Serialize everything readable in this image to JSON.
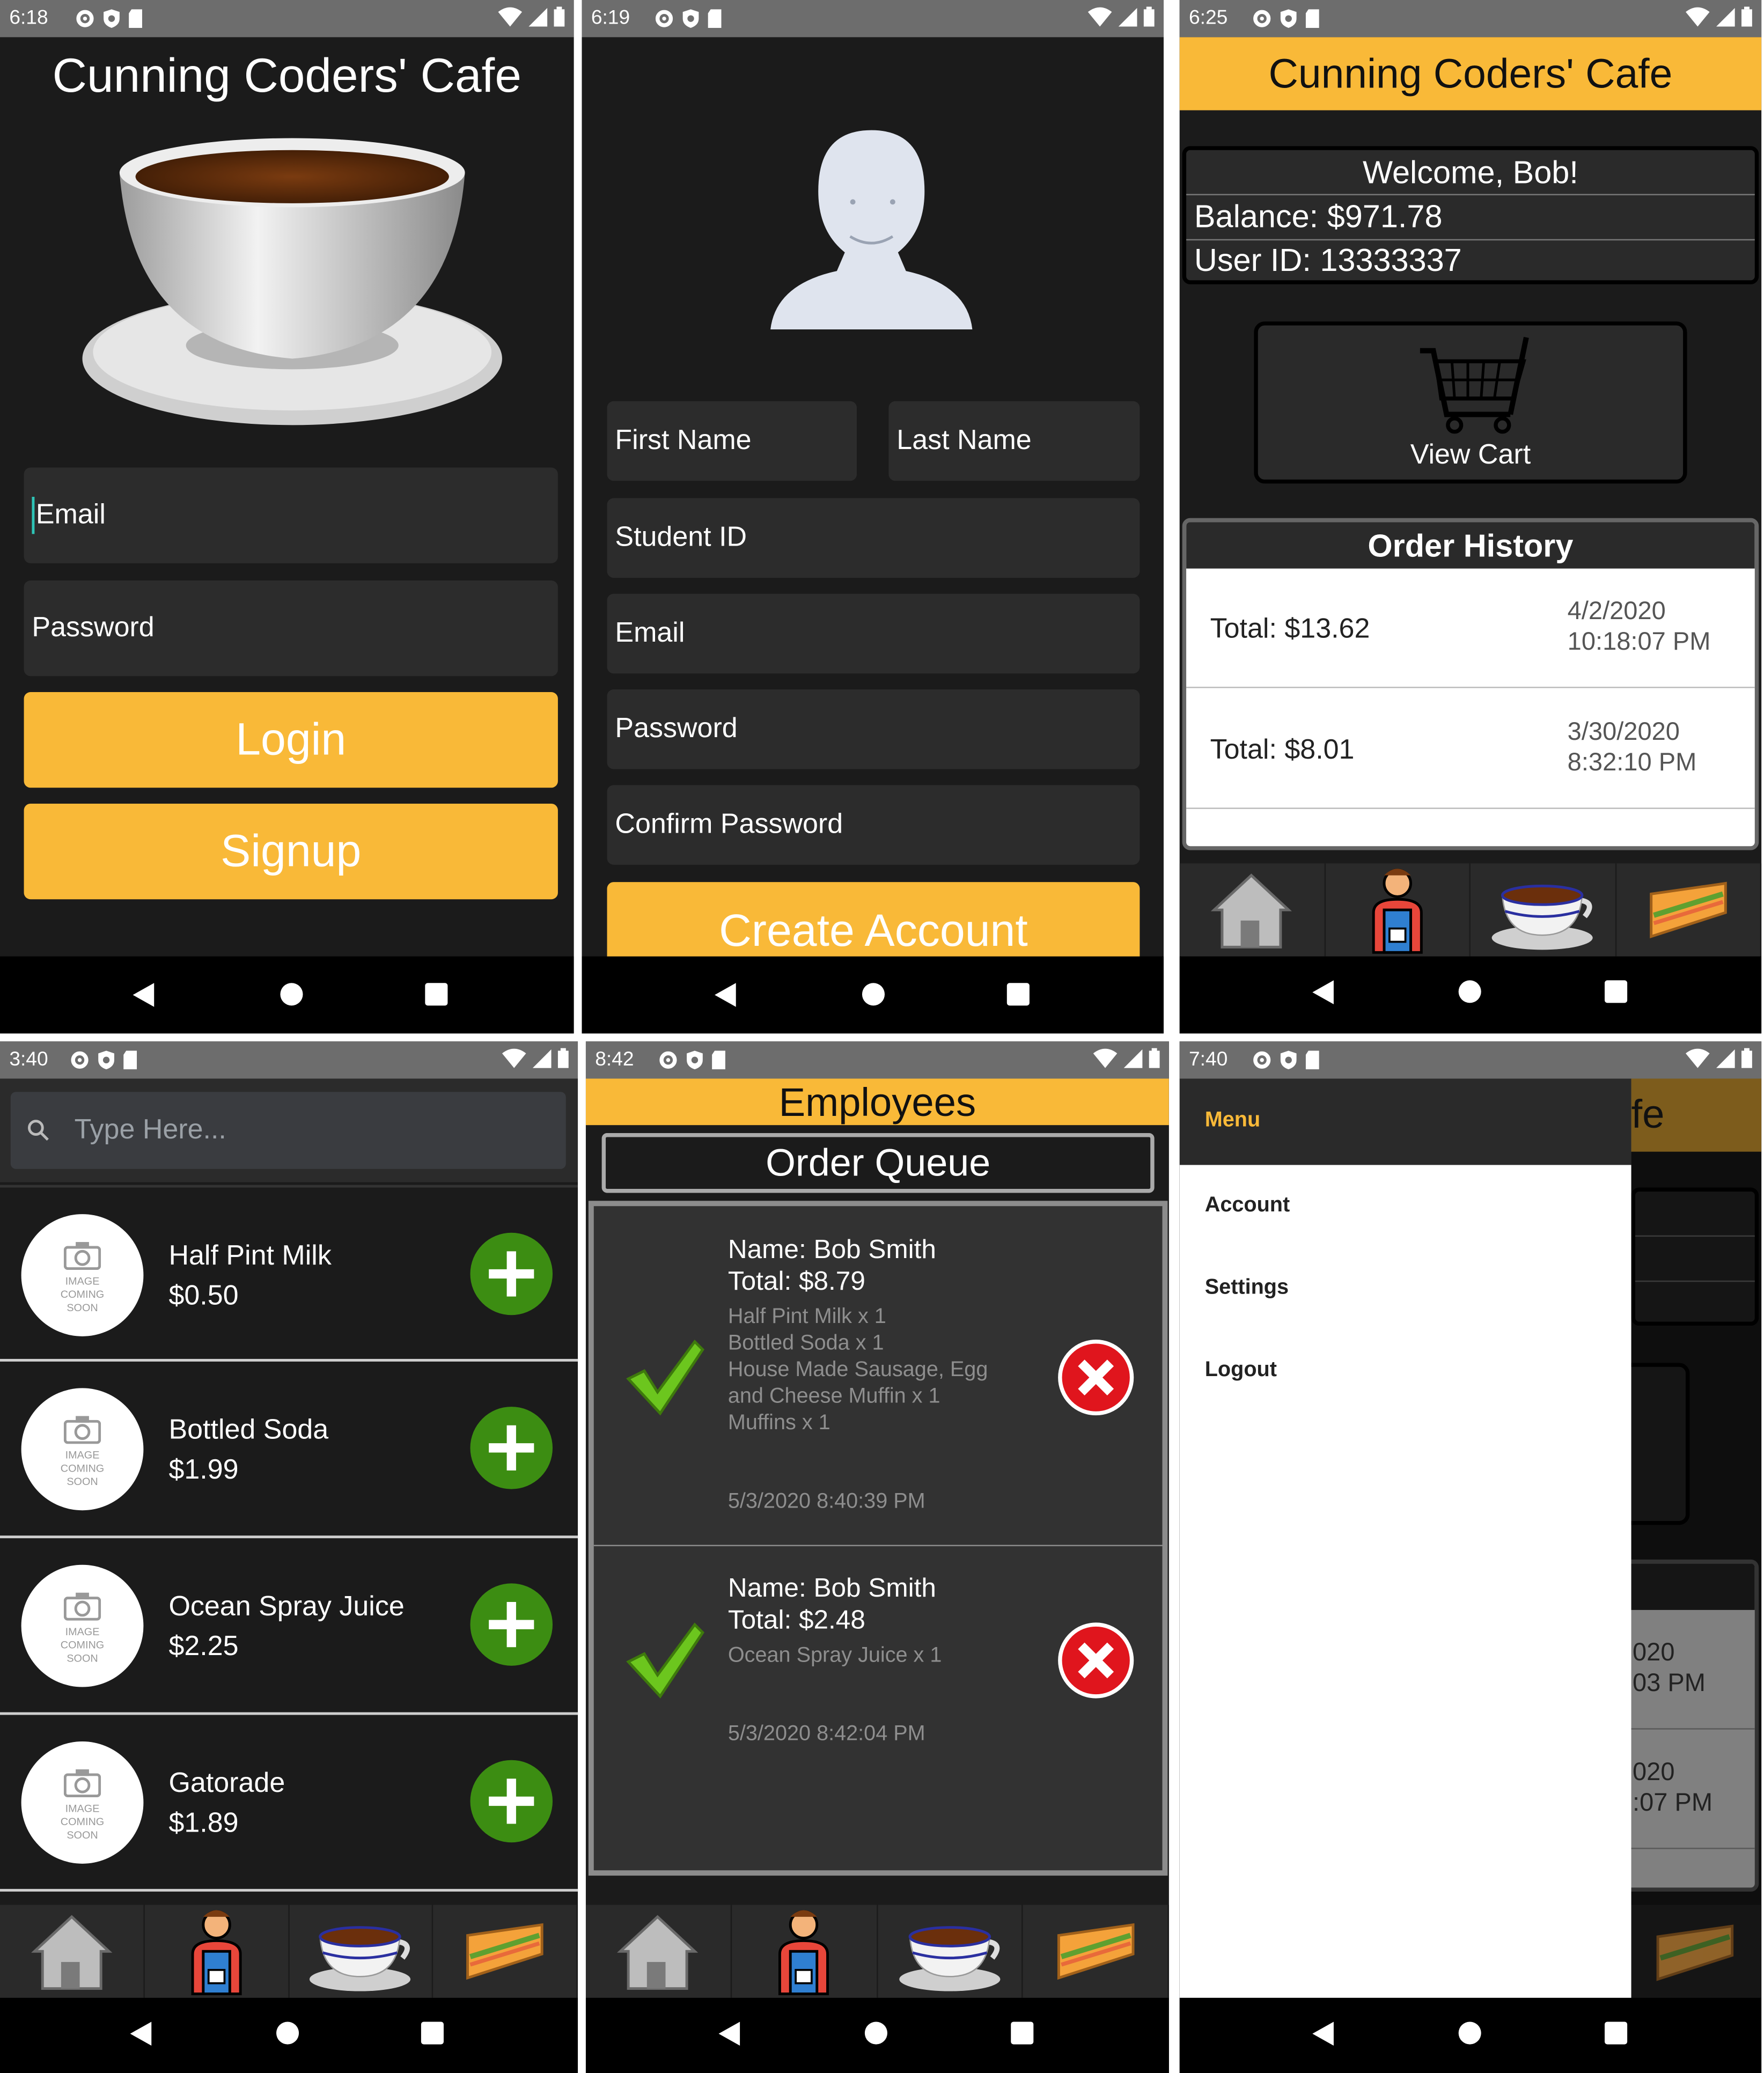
{
  "login": {
    "time": "6:18",
    "app_title": "Cunning Coders' Cafe",
    "email_placeholder": "Email",
    "password_placeholder": "Password",
    "login_label": "Login",
    "signup_label": "Signup"
  },
  "signup": {
    "time": "6:19",
    "first_name": "First Name",
    "last_name": "Last Name",
    "student_id": "Student ID",
    "email": "Email",
    "password": "Password",
    "confirm_password": "Confirm Password",
    "create_label": "Create Account"
  },
  "home": {
    "time": "6:25",
    "app_title": "Cunning Coders' Cafe",
    "welcome": "Welcome, Bob!",
    "balance": "Balance: $971.78",
    "user_id": "User ID: 13333337",
    "view_cart": "View Cart",
    "order_history_title": "Order History",
    "orders": [
      {
        "total": "Total: $13.62",
        "date": "4/2/2020",
        "time": "10:18:07 PM"
      },
      {
        "total": "Total: $8.01",
        "date": "3/30/2020",
        "time": "8:32:10 PM"
      }
    ]
  },
  "menu": {
    "time": "3:40",
    "search_placeholder": "Type Here...",
    "image_placeholder": [
      "IMAGE",
      "COMING",
      "SOON"
    ],
    "items": [
      {
        "name": "Half Pint Milk",
        "price": "$0.50"
      },
      {
        "name": "Bottled Soda",
        "price": "$1.99"
      },
      {
        "name": "Ocean Spray Juice",
        "price": "$2.25"
      },
      {
        "name": "Gatorade",
        "price": "$1.89"
      }
    ]
  },
  "employees": {
    "time": "8:42",
    "title": "Employees",
    "subtitle": "Order Queue",
    "orders": [
      {
        "name": "Name: Bob Smith",
        "total": "Total: $8.79",
        "items": [
          "Half Pint Milk x 1",
          "Bottled Soda x 1",
          "House Made Sausage, Egg",
          "and Cheese Muffin x 1",
          "Muffins x 1"
        ],
        "timestamp": "5/3/2020 8:40:39 PM"
      },
      {
        "name": "Name: Bob Smith",
        "total": "Total: $2.48",
        "items": [
          "Ocean Spray Juice x 1"
        ],
        "timestamp": "5/3/2020 8:42:04 PM"
      }
    ]
  },
  "drawer": {
    "time": "7:40",
    "header": "Menu",
    "items": [
      "Account",
      "Settings",
      "Logout"
    ],
    "bg_title_fragment": "fe",
    "bg_fragments": [
      {
        "a": "020",
        "b": "03 PM"
      },
      {
        "a": "020",
        "b": ":07 PM"
      }
    ]
  },
  "colors": {
    "accent": "#f9b938",
    "background": "#1b1b1b",
    "field": "#2c2c2c",
    "add_green": "#3c8d12",
    "reject_red": "#e0151d"
  }
}
